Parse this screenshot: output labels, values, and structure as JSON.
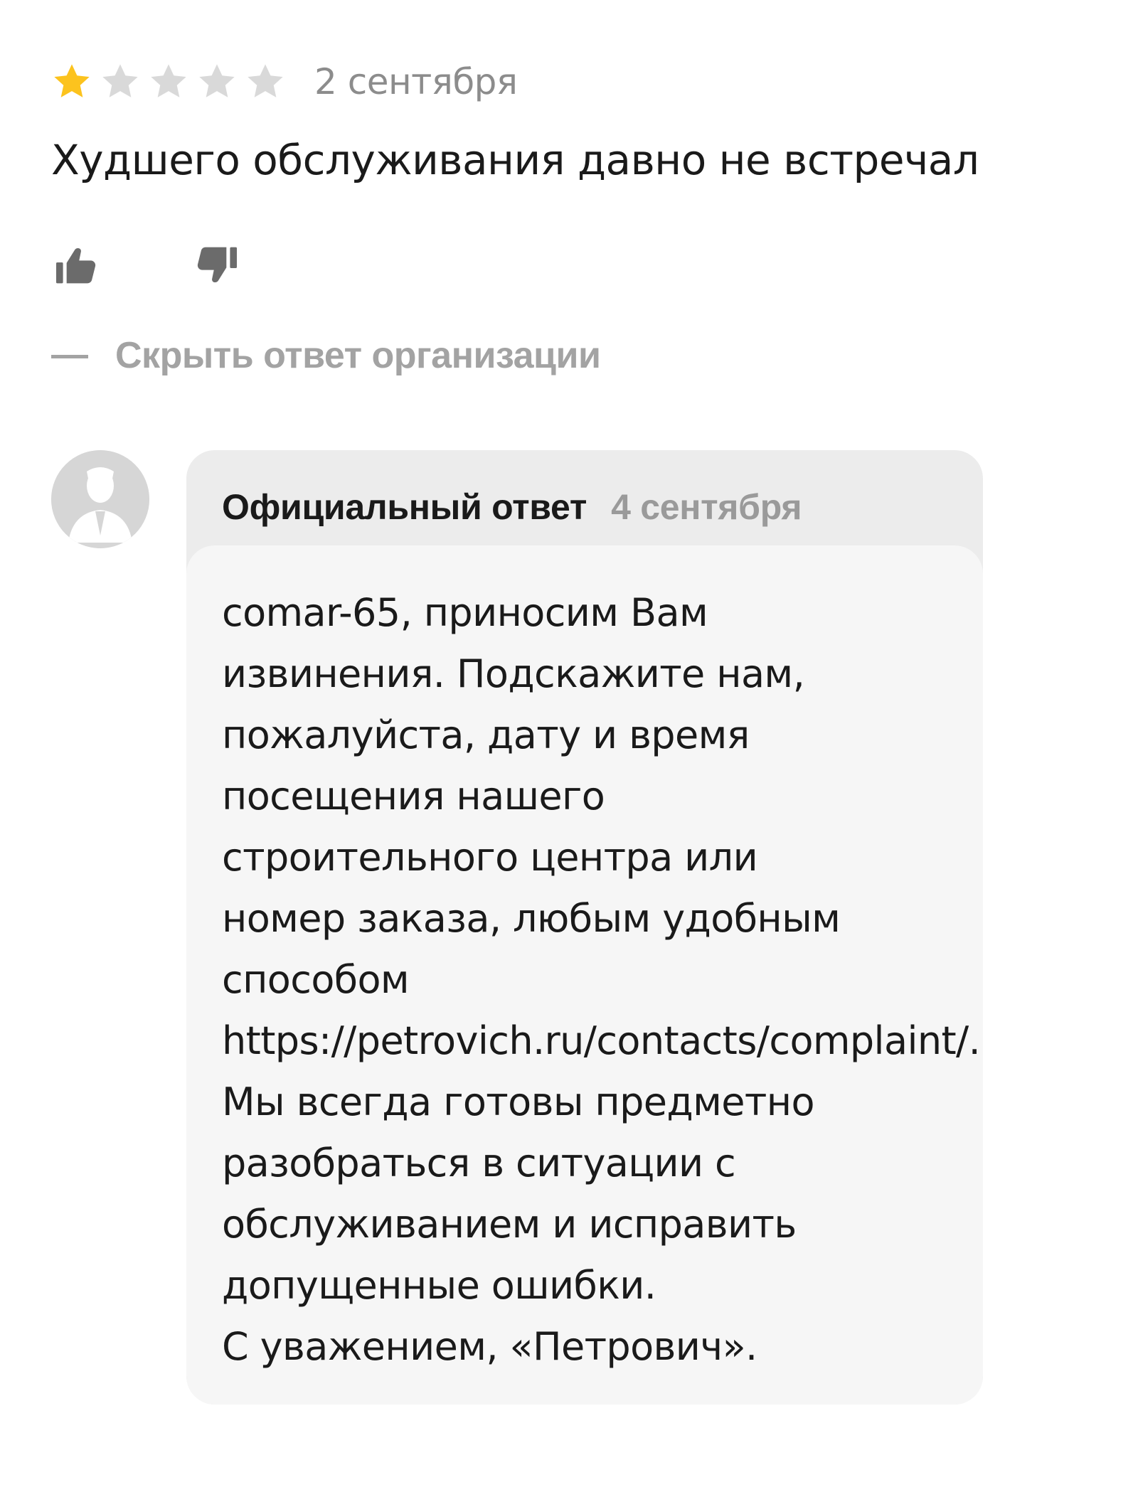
{
  "review": {
    "rating": 1,
    "max_rating": 5,
    "date": "2 сентября",
    "text": "Худшего обслуживания давно не встречал",
    "colors": {
      "star_filled": "#fcc31e",
      "star_empty": "#d9d9d9"
    },
    "icons": {
      "like": "thumbs-up-icon",
      "dislike": "thumbs-down-icon"
    }
  },
  "toggle": {
    "hide_reply_label": "Скрыть ответ организации"
  },
  "reply": {
    "title": "Официальный ответ",
    "date": "4 сентября",
    "avatar_icon": "organization-avatar-icon",
    "lines": [
      "comar-65, приносим Вам",
      "извинения. Подскажите нам,",
      "пожалуйста, дату и время",
      "посещения нашего",
      "строительного центра или",
      "номер заказа, любым удобным",
      "способом",
      "https://petrovich.ru/contacts/complaint/.",
      "Мы всегда готовы предметно",
      "разобраться в ситуации с",
      "обслуживанием и исправить",
      "допущенные ошибки.",
      "С уважением, «Петрович»."
    ]
  }
}
